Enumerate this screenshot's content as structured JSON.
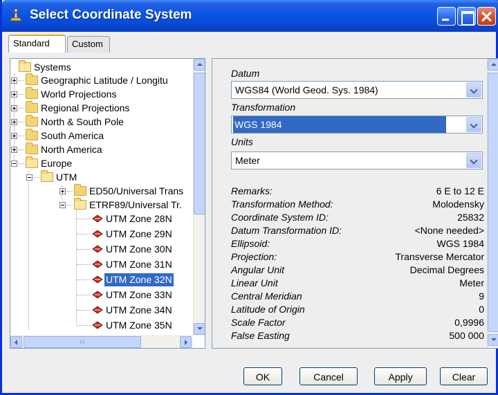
{
  "window": {
    "title": "Select Coordinate System",
    "controls": [
      "minimize-icon",
      "maximize-icon",
      "close-icon"
    ]
  },
  "tabs": [
    {
      "label": "Standard",
      "active": true
    },
    {
      "label": "Custom",
      "active": false
    }
  ],
  "tree": {
    "root": "Systems",
    "nodes": [
      "Geographic Latitude / Longitu",
      "World Projections",
      "Regional Projections",
      "North & South Pole",
      "South America",
      "North America",
      "Europe",
      "UTM",
      "ED50/Universal Trans",
      "ETRF89/Universal Tr.",
      "UTM Zone 28N",
      "UTM Zone 29N",
      "UTM Zone 30N",
      "UTM Zone 31N",
      "UTM Zone 32N",
      "UTM Zone 33N",
      "UTM Zone 34N",
      "UTM Zone 35N"
    ],
    "selected": "UTM Zone 32N",
    "hscroll_thumb_glyph": "III"
  },
  "details": {
    "datum_label": "Datum",
    "datum_value": "WGS84 (World Geod. Sys. 1984)",
    "transformation_label": "Transformation",
    "transformation_value": "WGS 1984",
    "units_label": "Units",
    "units_value": "Meter",
    "properties": [
      {
        "key": "Remarks:",
        "value": "6 E to 12 E"
      },
      {
        "key": "Transformation Method:",
        "value": "Molodensky"
      },
      {
        "key": "Coordinate System ID:",
        "value": "25832"
      },
      {
        "key": "Datum Transformation ID:",
        "value": "<None needed>"
      },
      {
        "key": "Ellipsoid:",
        "value": "WGS 1984"
      },
      {
        "key": "Projection:",
        "value": "Transverse Mercator"
      },
      {
        "key": "Angular Unit",
        "value": "Decimal Degrees"
      },
      {
        "key": "Linear Unit",
        "value": "Meter"
      },
      {
        "key": "Central Meridian",
        "value": "9"
      },
      {
        "key": "Latitude of Origin",
        "value": "0"
      },
      {
        "key": "Scale Factor",
        "value": "0,9996"
      },
      {
        "key": "False Easting",
        "value": "500 000"
      }
    ]
  },
  "buttons": {
    "ok": "OK",
    "cancel": "Cancel",
    "apply": "Apply",
    "clear": "Clear"
  },
  "colors": {
    "title_bar": "#0a56e5",
    "selection": "#316ac5",
    "close_button": "#d6502c"
  }
}
